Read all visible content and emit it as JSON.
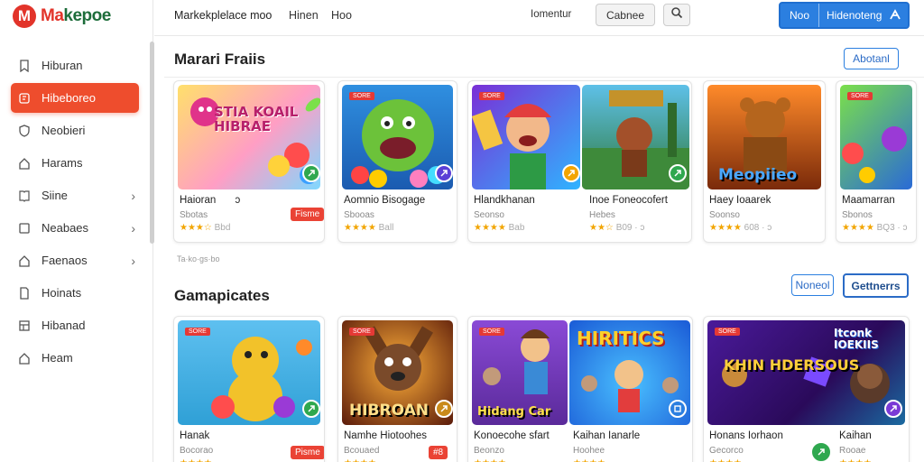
{
  "brand": {
    "name_a": "Ma",
    "name_b": "kepoe"
  },
  "topbar": {
    "title": "Markekplelace moo",
    "link1": "Hinen",
    "link2": "Hoo",
    "link3": "Iomentur",
    "grey_button": "Cabnee",
    "blue_left": "Noo",
    "blue_right": "Hidenoteng"
  },
  "sidebar": {
    "items": [
      {
        "label": "Hiburan",
        "icon": "bookmark-icon"
      },
      {
        "label": "Hibeboreo",
        "icon": "grid-icon",
        "active": true
      },
      {
        "label": "Neobieri",
        "icon": "shield-icon"
      },
      {
        "label": "Harams",
        "icon": "home-icon"
      },
      {
        "label": "Siine",
        "icon": "book-icon",
        "chevron": true
      },
      {
        "label": "Neabaes",
        "icon": "tablet-icon",
        "chevron": true
      },
      {
        "label": "Faenaos",
        "icon": "home-icon",
        "chevron": true
      },
      {
        "label": "Hoinats",
        "icon": "document-icon"
      },
      {
        "label": "Hibanad",
        "icon": "layout-icon"
      },
      {
        "label": "Heam",
        "icon": "home-icon"
      }
    ]
  },
  "section1": {
    "title": "Marari Fraiis",
    "action": "Abotanl",
    "hint": "Ta·ko·gs·bo",
    "cards": [
      {
        "name": "Haioran",
        "name_extra": "ɔ",
        "sub": "Sbotas",
        "rating": "★★★☆",
        "rating_text": "Bbd",
        "badge": "Fisme",
        "tag": "SORE",
        "art_text": "STIA KOAIL HIBRAE"
      },
      {
        "name": "Aomnio Bisogage",
        "sub": "Sbooas",
        "rating": "★★★★",
        "rating_text": "Ball",
        "tag": "SORE"
      },
      {
        "name": "Hlandkhanan",
        "sub": "Seonso",
        "rating": "★★★★",
        "rating_text": "Bab",
        "tag": "SORE",
        "wide": true,
        "name2": "Inoe Foneocofert",
        "sub2": "Hebes",
        "rating2": "★★☆",
        "rating2_text": "B09 · ɔ"
      },
      {
        "name": "Haey Ioaarek",
        "sub": "Soonso",
        "rating": "★★★★",
        "rating_text": "608 · ɔ",
        "art_text": "Meopiieo"
      },
      {
        "name": "Maamarran",
        "sub": "Sbonos",
        "rating": "★★★★",
        "rating_text": "BQ3 · ɔ",
        "tag": "SORE"
      }
    ]
  },
  "section2": {
    "title": "Gamapicates",
    "action_left": "Noneol",
    "action_right": "Gettnerrs",
    "cards": [
      {
        "name": "Hanak",
        "sub": "Bocorao",
        "rating": "★★★★",
        "badge": "Pisme",
        "tag": "SORE"
      },
      {
        "name": "Namhe Hiotoohes",
        "sub": "Bcouaed",
        "rating": "★★★★",
        "badge": "#8",
        "tag": "SORE",
        "art_text": "HIBROAN"
      },
      {
        "name": "Konoecohe sfart",
        "sub": "Beonzo",
        "rating": "★★★★",
        "tag": "SORE",
        "wide": true,
        "name2": "Kaihan Ianarle",
        "sub2": "Hoohee",
        "rating2": "★★★★",
        "art_text": "Hidang Car",
        "art_text2": "HIRITICS"
      },
      {
        "name": "Honans Iorhaon",
        "sub": "Gecorco",
        "rating": "★★★★",
        "tag": "SORE",
        "wide": true,
        "name2": "Kaihan",
        "sub2": "Rooae",
        "rating2": "★★★★",
        "art_text": "KHIN HDERSOUS",
        "art_text2": "Itconk IOEKIIS"
      }
    ]
  },
  "colors": {
    "accent": "#ee4d2d",
    "primary": "#2b7fe0",
    "green": "#2fa84f",
    "star": "#f2a500"
  }
}
